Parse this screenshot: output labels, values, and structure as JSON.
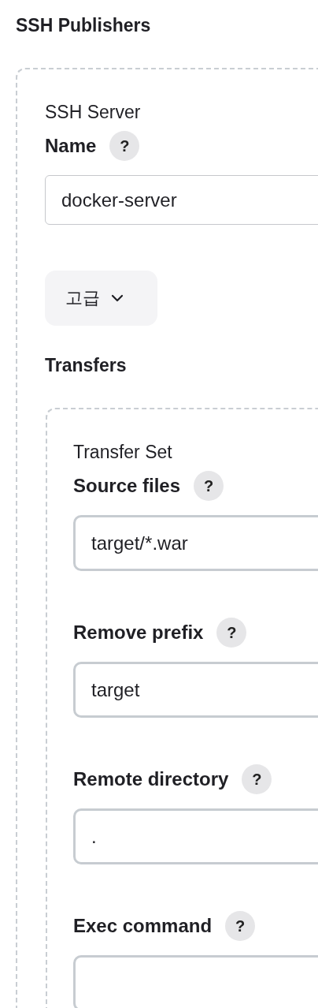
{
  "title": "SSH Publishers",
  "server": {
    "heading": "SSH Server",
    "fields": [
      {
        "label": "Name",
        "help": "?",
        "value": "docker-server"
      }
    ],
    "advanced_button": "고급",
    "transfers_title": "Transfers",
    "transfer_set": {
      "heading": "Transfer Set",
      "fields": [
        {
          "label": "Source files",
          "help": "?",
          "value": "target/*.war"
        },
        {
          "label": "Remove prefix",
          "help": "?",
          "value": "target"
        },
        {
          "label": "Remote directory",
          "help": "?",
          "value": "."
        },
        {
          "label": "Exec command",
          "help": "?"
        }
      ]
    }
  }
}
